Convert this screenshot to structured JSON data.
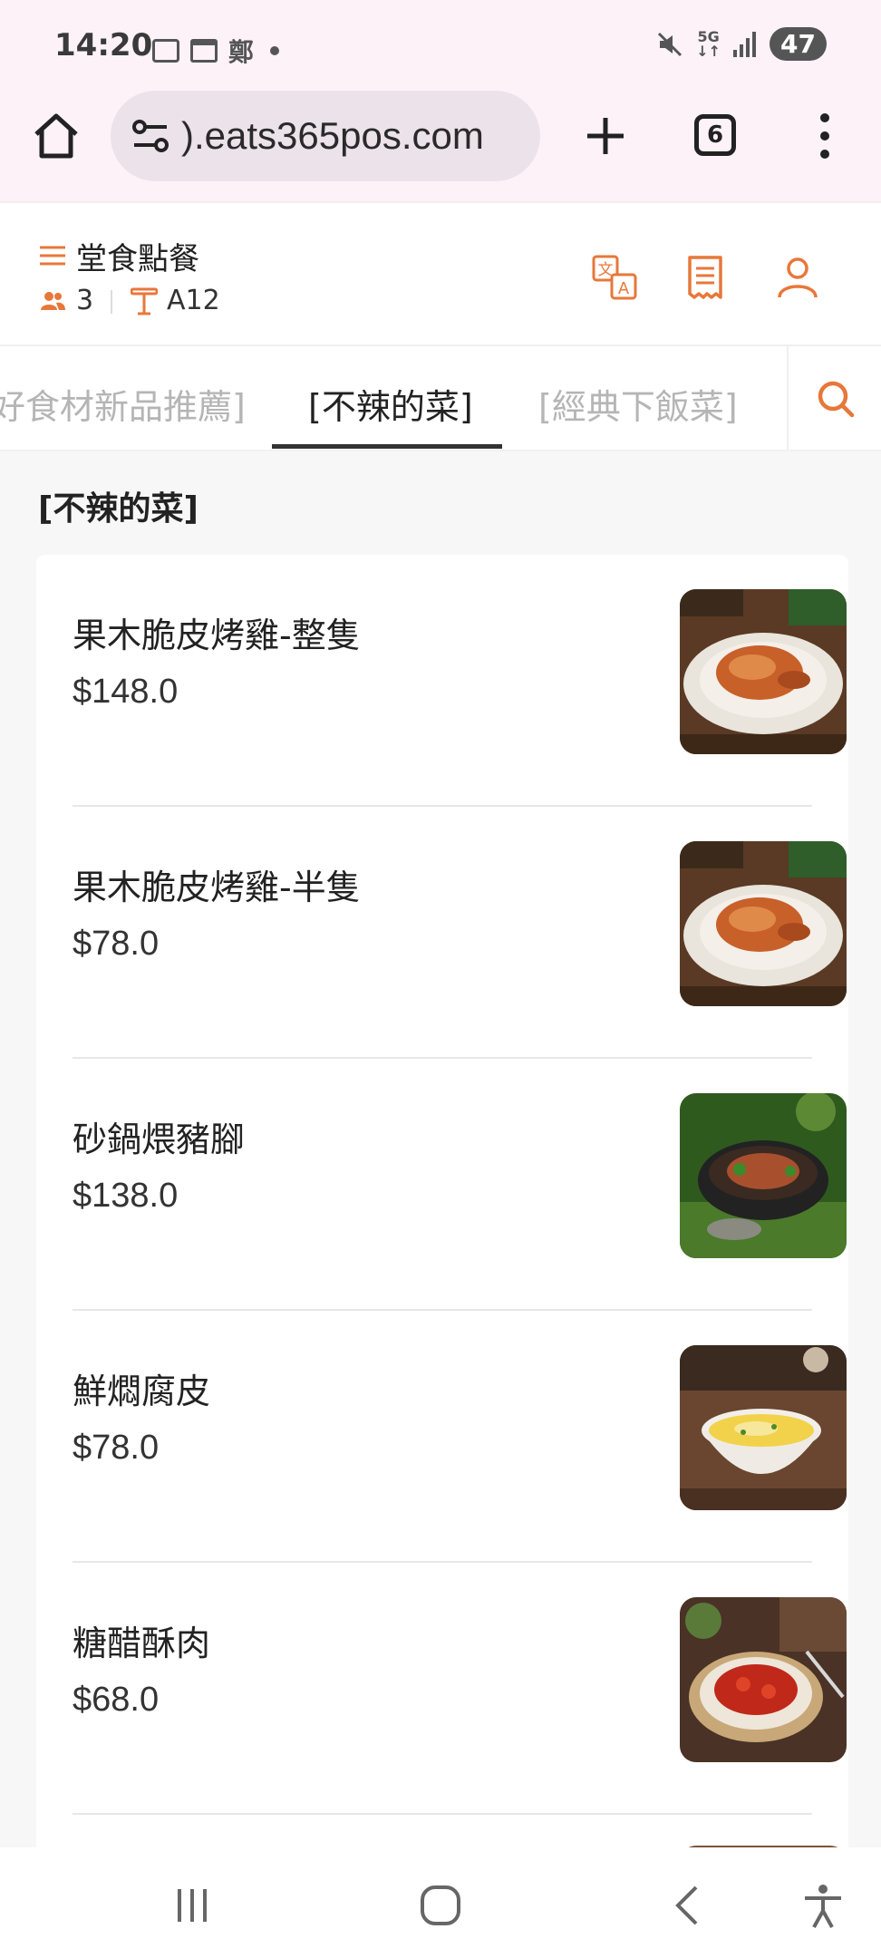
{
  "status_bar": {
    "time": "14:20",
    "network": "5G",
    "battery": "47",
    "icons": [
      "screenshot-icon",
      "calendar-icon",
      "app-icon",
      "dot-icon",
      "mute-icon",
      "signal-icon"
    ]
  },
  "browser": {
    "url": ").eats365pos.com",
    "tab_count": "6"
  },
  "header": {
    "title": "堂食點餐",
    "guests": "3",
    "table": "A12"
  },
  "categories": {
    "tabs": [
      "好食材新品推薦]",
      "[不辣的菜]",
      "[經典下飯菜]"
    ],
    "active_index": 1
  },
  "section": {
    "title": "[不辣的菜]"
  },
  "items": [
    {
      "name": "果木脆皮烤雞-整隻",
      "price": "$148.0",
      "image": "roast-chicken"
    },
    {
      "name": "果木脆皮烤雞-半隻",
      "price": "$78.0",
      "image": "roast-chicken"
    },
    {
      "name": "砂鍋煨豬腳",
      "price": "$138.0",
      "image": "claypot-pork-trotter"
    },
    {
      "name": "鮮燜腐皮",
      "price": "$78.0",
      "image": "braised-tofu-skin"
    },
    {
      "name": "糖醋酥肉",
      "price": "$68.0",
      "image": "sweet-sour-pork"
    }
  ],
  "colors": {
    "accent": "#e8773a",
    "browser_bg": "#fcf2f8",
    "content_bg": "#f7f7f8"
  }
}
